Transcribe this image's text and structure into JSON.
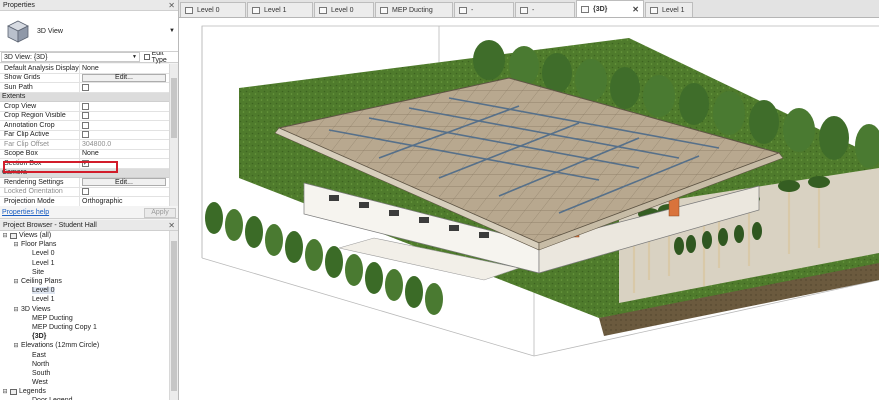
{
  "properties": {
    "title": "Properties",
    "close": "✕",
    "type_name": "3D View",
    "view_selector": "3D View: {3D}",
    "edit_type": "Edit Type",
    "rows": [
      {
        "kind": "row",
        "key": "Default Analysis Display St...",
        "value": "None"
      },
      {
        "kind": "row",
        "key": "Show Grids",
        "button": "Edit..."
      },
      {
        "kind": "row",
        "key": "Sun Path",
        "check": ""
      },
      {
        "kind": "cat",
        "key": "Extents"
      },
      {
        "kind": "row",
        "key": "Crop View",
        "check": ""
      },
      {
        "kind": "row",
        "key": "Crop Region Visible",
        "check": ""
      },
      {
        "kind": "row",
        "key": "Annotation Crop",
        "check": ""
      },
      {
        "kind": "row",
        "key": "Far Clip Active",
        "check": ""
      },
      {
        "kind": "row",
        "key": "Far Clip Offset",
        "value": "304800.0",
        "grey": true
      },
      {
        "kind": "row",
        "key": "Scope Box",
        "value": "None"
      },
      {
        "kind": "row",
        "key": "Section Box",
        "check": "✓"
      },
      {
        "kind": "cat",
        "key": "Camera"
      },
      {
        "kind": "row",
        "key": "Rendering Settings",
        "button": "Edit..."
      },
      {
        "kind": "row",
        "key": "Locked Orientation",
        "check": "",
        "grey": true
      },
      {
        "kind": "row",
        "key": "Projection Mode",
        "value": "Orthographic"
      }
    ],
    "help_link": "Properties help",
    "apply": "Apply"
  },
  "browser": {
    "title": "Project Browser - Student Hall",
    "close": "✕",
    "items": [
      {
        "indent": 0,
        "toggle": "⊟",
        "label": "Views (all)",
        "icon": true
      },
      {
        "indent": 1,
        "toggle": "⊟",
        "label": "Floor Plans"
      },
      {
        "indent": 2,
        "label": "Level 0"
      },
      {
        "indent": 2,
        "label": "Level 1"
      },
      {
        "indent": 2,
        "label": "Site"
      },
      {
        "indent": 1,
        "toggle": "⊟",
        "label": "Ceiling Plans"
      },
      {
        "indent": 2,
        "label": "Level 0",
        "selected": true
      },
      {
        "indent": 2,
        "label": "Level 1"
      },
      {
        "indent": 1,
        "toggle": "⊟",
        "label": "3D Views"
      },
      {
        "indent": 2,
        "label": "MEP Ducting"
      },
      {
        "indent": 2,
        "label": "MEP Ducting Copy 1"
      },
      {
        "indent": 2,
        "label": "{3D}",
        "bold": true
      },
      {
        "indent": 1,
        "toggle": "⊟",
        "label": "Elevations (12mm Circle)"
      },
      {
        "indent": 2,
        "label": "East"
      },
      {
        "indent": 2,
        "label": "North"
      },
      {
        "indent": 2,
        "label": "South"
      },
      {
        "indent": 2,
        "label": "West"
      },
      {
        "indent": 0,
        "toggle": "⊟",
        "label": "Legends",
        "icon": true
      },
      {
        "indent": 2,
        "label": "Door Legend"
      }
    ]
  },
  "tabs": [
    {
      "label": "Level 0"
    },
    {
      "label": "Level 1"
    },
    {
      "label": "Level 0"
    },
    {
      "label": "MEP Ducting"
    },
    {
      "label": "-"
    },
    {
      "label": "-"
    },
    {
      "label": "{3D}",
      "active": true,
      "close": "✕"
    },
    {
      "label": "Level 1"
    }
  ]
}
